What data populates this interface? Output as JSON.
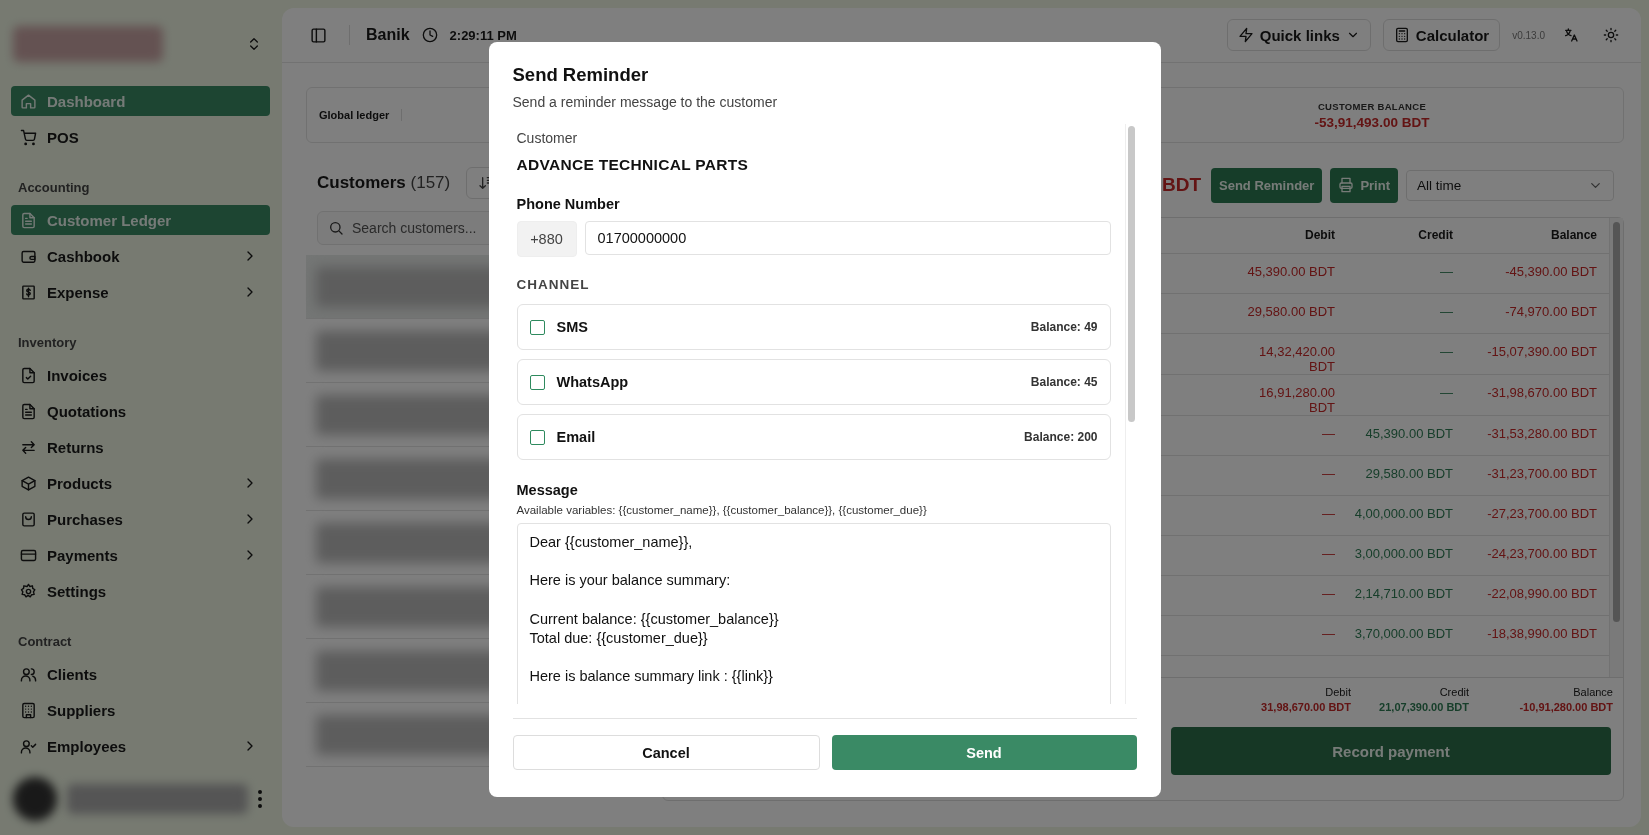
{
  "sidebar": {
    "groups": [
      {
        "items": [
          {
            "label": "Dashboard",
            "selected": true,
            "has_submenu": false
          },
          {
            "label": "POS",
            "selected": false,
            "has_submenu": false
          }
        ]
      },
      {
        "heading": "Accounting",
        "items": [
          {
            "label": "Customer Ledger",
            "selected": true,
            "has_submenu": false
          },
          {
            "label": "Cashbook",
            "selected": false,
            "has_submenu": true
          },
          {
            "label": "Expense",
            "selected": false,
            "has_submenu": true
          }
        ]
      },
      {
        "heading": "Inventory",
        "items": [
          {
            "label": "Invoices",
            "selected": false,
            "has_submenu": false
          },
          {
            "label": "Quotations",
            "selected": false,
            "has_submenu": false
          },
          {
            "label": "Returns",
            "selected": false,
            "has_submenu": false
          },
          {
            "label": "Products",
            "selected": false,
            "has_submenu": true
          },
          {
            "label": "Purchases",
            "selected": false,
            "has_submenu": true
          },
          {
            "label": "Payments",
            "selected": false,
            "has_submenu": true
          },
          {
            "label": "Settings",
            "selected": false,
            "has_submenu": false
          }
        ]
      },
      {
        "heading": "Contract",
        "items": [
          {
            "label": "Clients",
            "selected": false,
            "has_submenu": false
          },
          {
            "label": "Suppliers",
            "selected": false,
            "has_submenu": false
          },
          {
            "label": "Employees",
            "selected": false,
            "has_submenu": true
          }
        ]
      }
    ]
  },
  "header": {
    "title": "Banik",
    "time": "2:29:11 PM",
    "quick_links": "Quick links",
    "calculator": "Calculator",
    "version": "v0.13.0"
  },
  "summary": {
    "label": "Global ledger",
    "balance_label": "CUSTOMER BALANCE",
    "balance_value": "-53,91,493.00 BDT"
  },
  "customers": {
    "title": "Customers",
    "count": "(157)",
    "search_placeholder": "Search customers...",
    "rows": [
      {
        "selected": true
      },
      {
        "selected": false
      },
      {
        "selected": false
      },
      {
        "selected": false
      },
      {
        "selected": false
      },
      {
        "selected": false
      },
      {
        "selected": false
      },
      {
        "selected": false
      }
    ]
  },
  "ledger": {
    "total_fragment": "BDT",
    "send_reminder": "Send Reminder",
    "print": "Print",
    "period": "All time",
    "columns": [
      "Debit",
      "Credit",
      "Balance"
    ],
    "rows": [
      {
        "debit": "45,390.00 BDT",
        "credit": "—",
        "balance": "-45,390.00 BDT"
      },
      {
        "debit": "29,580.00 BDT",
        "credit": "—",
        "balance": "-74,970.00 BDT"
      },
      {
        "debit": "14,32,420.00 BDT",
        "credit": "—",
        "balance": "-15,07,390.00 BDT"
      },
      {
        "debit": "16,91,280.00 BDT",
        "credit": "—",
        "balance": "-31,98,670.00 BDT"
      },
      {
        "debit": "—",
        "credit": "45,390.00 BDT",
        "balance": "-31,53,280.00 BDT"
      },
      {
        "debit": "—",
        "credit": "29,580.00 BDT",
        "balance": "-31,23,700.00 BDT"
      },
      {
        "debit": "—",
        "credit": "4,00,000.00 BDT",
        "balance": "-27,23,700.00 BDT"
      },
      {
        "debit": "—",
        "credit": "3,00,000.00 BDT",
        "balance": "-24,23,700.00 BDT"
      },
      {
        "debit": "—",
        "credit": "2,14,710.00 BDT",
        "balance": "-22,08,990.00 BDT"
      },
      {
        "debit": "—",
        "credit": "3,70,000.00 BDT",
        "balance": "-18,38,990.00 BDT"
      }
    ],
    "totals": [
      {
        "label": "Debit",
        "value": "31,98,670.00 BDT"
      },
      {
        "label": "Credit",
        "value": "21,07,390.00 BDT"
      },
      {
        "label": "Balance",
        "value": "-10,91,280.00 BDT"
      }
    ],
    "record_payment": "Record payment"
  },
  "dialog": {
    "title": "Send Reminder",
    "subtitle": "Send a reminder message to the customer",
    "customer_label": "Customer",
    "customer_name": "ADVANCE TECHNICAL PARTS",
    "phone_label": "Phone Number",
    "country_code": "+880",
    "phone": "01700000000",
    "channel_heading": "CHANNEL",
    "channels": [
      {
        "name": "SMS",
        "balance": "Balance: 49",
        "checked": false
      },
      {
        "name": "WhatsApp",
        "balance": "Balance: 45",
        "checked": false
      },
      {
        "name": "Email",
        "balance": "Balance: 200",
        "checked": false
      }
    ],
    "message_label": "Message",
    "variables_hint": "Available variables: {{customer_name}}, {{customer_balance}}, {{customer_due}}",
    "message": "Dear {{customer_name}},\n\nHere is your balance summary:\n\nCurrent balance: {{customer_balance}}\nTotal due: {{customer_due}}\n\nHere is balance summary link : {{link}}",
    "cancel": "Cancel",
    "send": "Send"
  }
}
